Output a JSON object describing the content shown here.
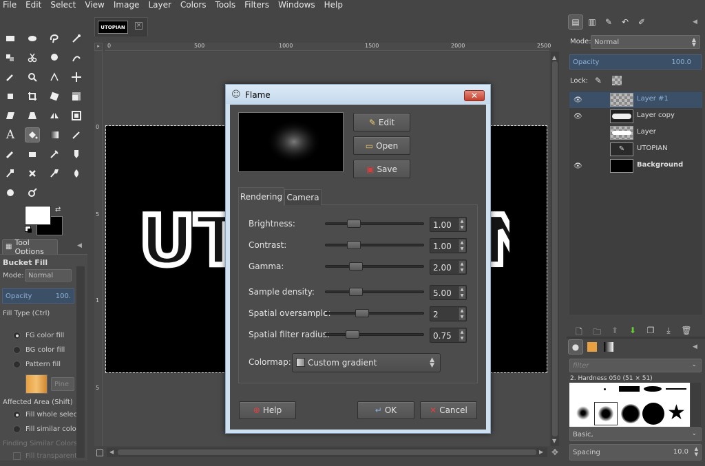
{
  "menubar": {
    "items": [
      {
        "label": "File"
      },
      {
        "label": "Edit"
      },
      {
        "label": "Select"
      },
      {
        "label": "View"
      },
      {
        "label": "Image"
      },
      {
        "label": "Layer"
      },
      {
        "label": "Colors"
      },
      {
        "label": "Tools"
      },
      {
        "label": "Filters"
      },
      {
        "label": "Windows"
      },
      {
        "label": "Help"
      }
    ]
  },
  "toolbox": {
    "tool_options_tab": "Tool Options",
    "tool_name": "Bucket Fill",
    "mode_label": "Mode:",
    "mode_value": "Normal",
    "opacity_label": "Opacity",
    "opacity_value": "100.",
    "fill_type_label": "Fill Type  (Ctrl)",
    "fill_fg": "FG color fill",
    "fill_bg": "BG color fill",
    "fill_pattern": "Pattern fill",
    "pattern_name": "Pine",
    "affected_area_label": "Affected Area  (Shift)",
    "fill_whole": "Fill whole selecti",
    "fill_similar": "Fill similar colors",
    "finding_similar": "Finding Similar Colors",
    "fill_transparent": "Fill transparent a"
  },
  "image_window": {
    "thumb_text": "UTOPIAN",
    "ruler_h": [
      "0",
      "500",
      "1000",
      "1500",
      "2000",
      "2500"
    ],
    "ruler_v": [
      "0",
      "5",
      "1",
      "5"
    ],
    "canvas_text_left": "UT",
    "canvas_text_right": "N"
  },
  "layers": {
    "mode_label": "Mode:",
    "mode_value": "Normal",
    "opacity_label": "Opacity",
    "opacity_value": "100.0",
    "lock_label": "Lock:",
    "items": [
      {
        "name": "Layer #1",
        "visible": true,
        "selected": true
      },
      {
        "name": "Layer copy",
        "visible": true,
        "selected": false
      },
      {
        "name": "Layer",
        "visible": false,
        "selected": false
      },
      {
        "name": "UTOPIAN",
        "visible": false,
        "selected": false
      },
      {
        "name": "Background",
        "visible": true,
        "selected": false
      }
    ]
  },
  "brushes": {
    "filter_placeholder": "filter",
    "brush_name": "2. Hardness 050 (51 × 51)",
    "preset_value": "Basic,",
    "spacing_label": "Spacing",
    "spacing_value": "10.0"
  },
  "flame_dialog": {
    "title": "Flame",
    "edit_label": "Edit",
    "open_label": "Open",
    "save_label": "Save",
    "tabs": [
      {
        "label": "Rendering"
      },
      {
        "label": "Camera"
      }
    ],
    "params": [
      {
        "label": "Brightness:",
        "value": "1.00",
        "pos": 0.25
      },
      {
        "label": "Contrast:",
        "value": "1.00",
        "pos": 0.25
      },
      {
        "label": "Gamma:",
        "value": "2.00",
        "pos": 0.28
      },
      {
        "label": "Sample density:",
        "value": "5.00",
        "pos": 0.28
      },
      {
        "label": "Spatial oversample:",
        "value": "2",
        "pos": 0.35
      },
      {
        "label": "Spatial filter radius:",
        "value": "0.75",
        "pos": 0.24
      }
    ],
    "colormap_label": "Colormap:",
    "colormap_value": "Custom gradient",
    "help_label": "Help",
    "ok_label": "OK",
    "cancel_label": "Cancel"
  }
}
